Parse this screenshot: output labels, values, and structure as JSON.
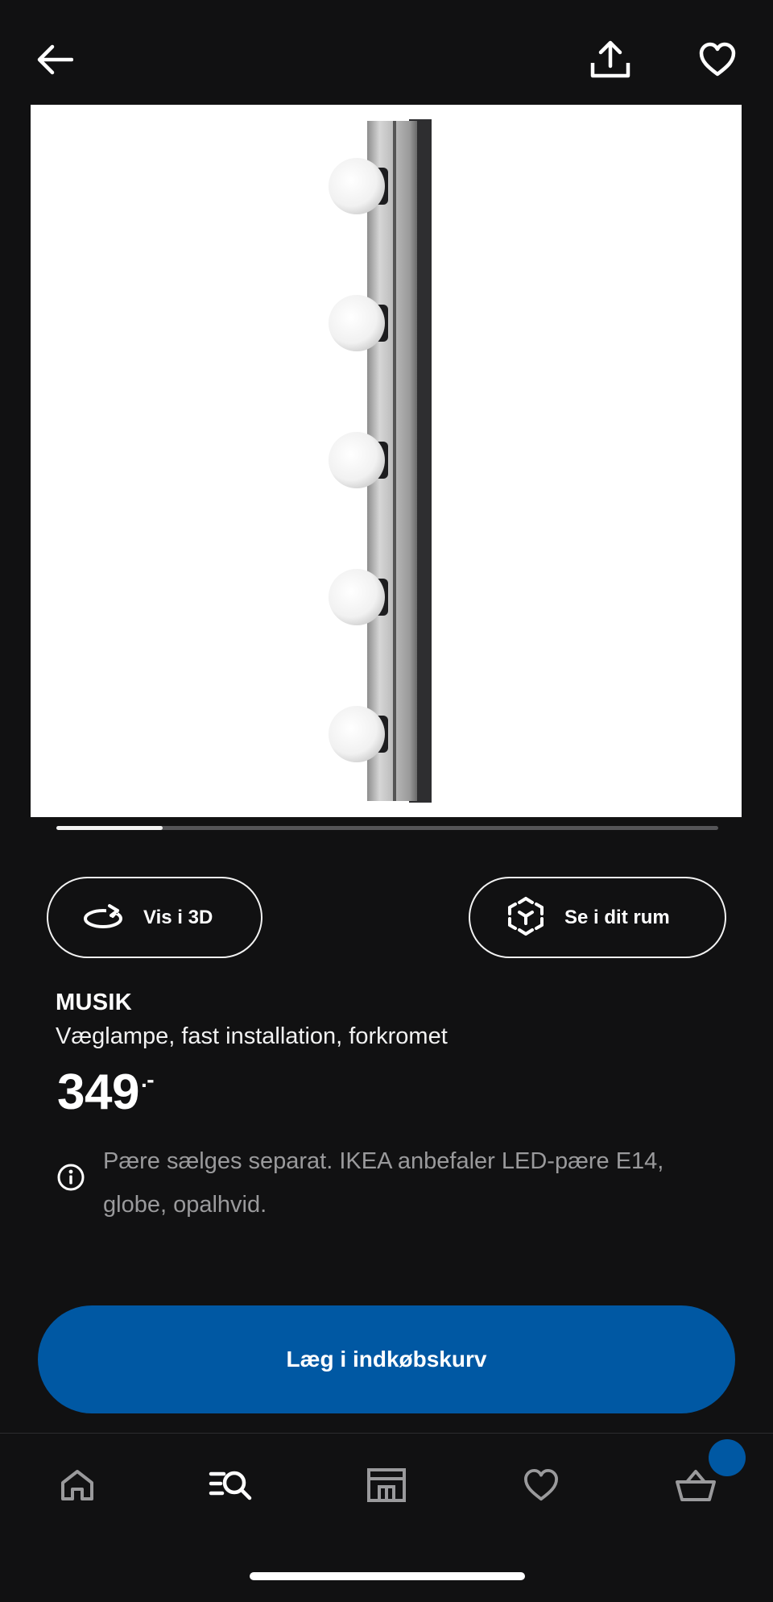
{
  "header": {
    "back_icon": "arrow-left-icon",
    "share_icon": "share-icon",
    "favorite_icon": "heart-icon"
  },
  "gallery": {
    "image": "MUSIK wall lamp with five globe bulbs on chrome bar",
    "progress": 0.16
  },
  "actions": {
    "view_3d_label": "Vis i 3D",
    "view_3d_icon": "rotate-3d-icon",
    "ar_label": "Se i dit rum",
    "ar_icon": "ar-cube-icon"
  },
  "product": {
    "name": "MUSIK",
    "description": "Væglampe, fast installation, forkromet",
    "price": "349",
    "price_suffix": ".-",
    "info_icon": "info-icon",
    "info_text": "Pære sælges separat. IKEA anbefaler LED-pære E14, globe, opalhvid."
  },
  "cta": {
    "label": "Læg i indkøbskurv",
    "color": "#0058a3"
  },
  "nav": {
    "items": [
      {
        "icon": "home-icon"
      },
      {
        "icon": "search-list-icon"
      },
      {
        "icon": "store-icon"
      },
      {
        "icon": "heart-icon"
      },
      {
        "icon": "basket-icon"
      }
    ],
    "badge_color": "#0058a3"
  }
}
